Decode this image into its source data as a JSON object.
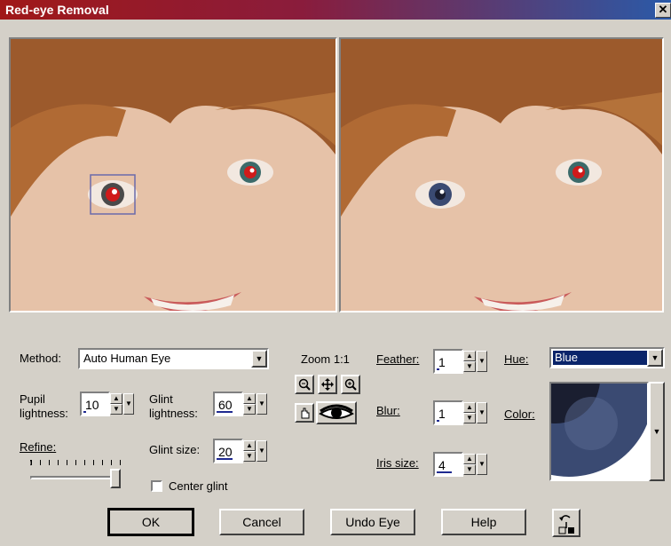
{
  "window": {
    "title": "Red-eye Removal",
    "close_symbol": "✕"
  },
  "method": {
    "label": "Method:",
    "value": "Auto Human Eye"
  },
  "pupil_lightness": {
    "label_line1": "Pupil",
    "label_line2": "lightness:",
    "value": "10",
    "level": 0.1
  },
  "glint_lightness": {
    "label_line1": "Glint",
    "label_line2": "lightness:",
    "value": "60",
    "level": 0.6
  },
  "glint_size": {
    "label": "Glint size:",
    "value": "20",
    "level": 0.6
  },
  "refine": {
    "label": "Refine:",
    "level": 1.0
  },
  "center_glint": {
    "label": "Center glint",
    "checked": false
  },
  "zoom": {
    "label": "Zoom 1:1"
  },
  "feather": {
    "label": "Feather:",
    "value": "1",
    "level": 0.1
  },
  "blur": {
    "label": "Blur:",
    "value": "1",
    "level": 0.1
  },
  "iris_size": {
    "label": "Iris size:",
    "value": "4",
    "level": 0.55
  },
  "hue": {
    "label": "Hue:",
    "value": "Blue"
  },
  "color": {
    "label": "Color:"
  },
  "buttons": {
    "ok": "OK",
    "cancel": "Cancel",
    "undo_eye": "Undo Eye",
    "help": "Help"
  },
  "colors": {
    "skin": "#e6c2a8",
    "hair": "#9c5a2c",
    "iris_blue": "#3a4a72",
    "red_pupil": "#d01a1a",
    "accent": "#0a246a"
  },
  "icons": [
    "zoom-out-icon",
    "move-icon",
    "zoom-in-icon",
    "hand-pan-icon",
    "eye-icon",
    "reset-defaults-icon",
    "dropdown-arrow-icon",
    "spin-arrows-icon"
  ]
}
